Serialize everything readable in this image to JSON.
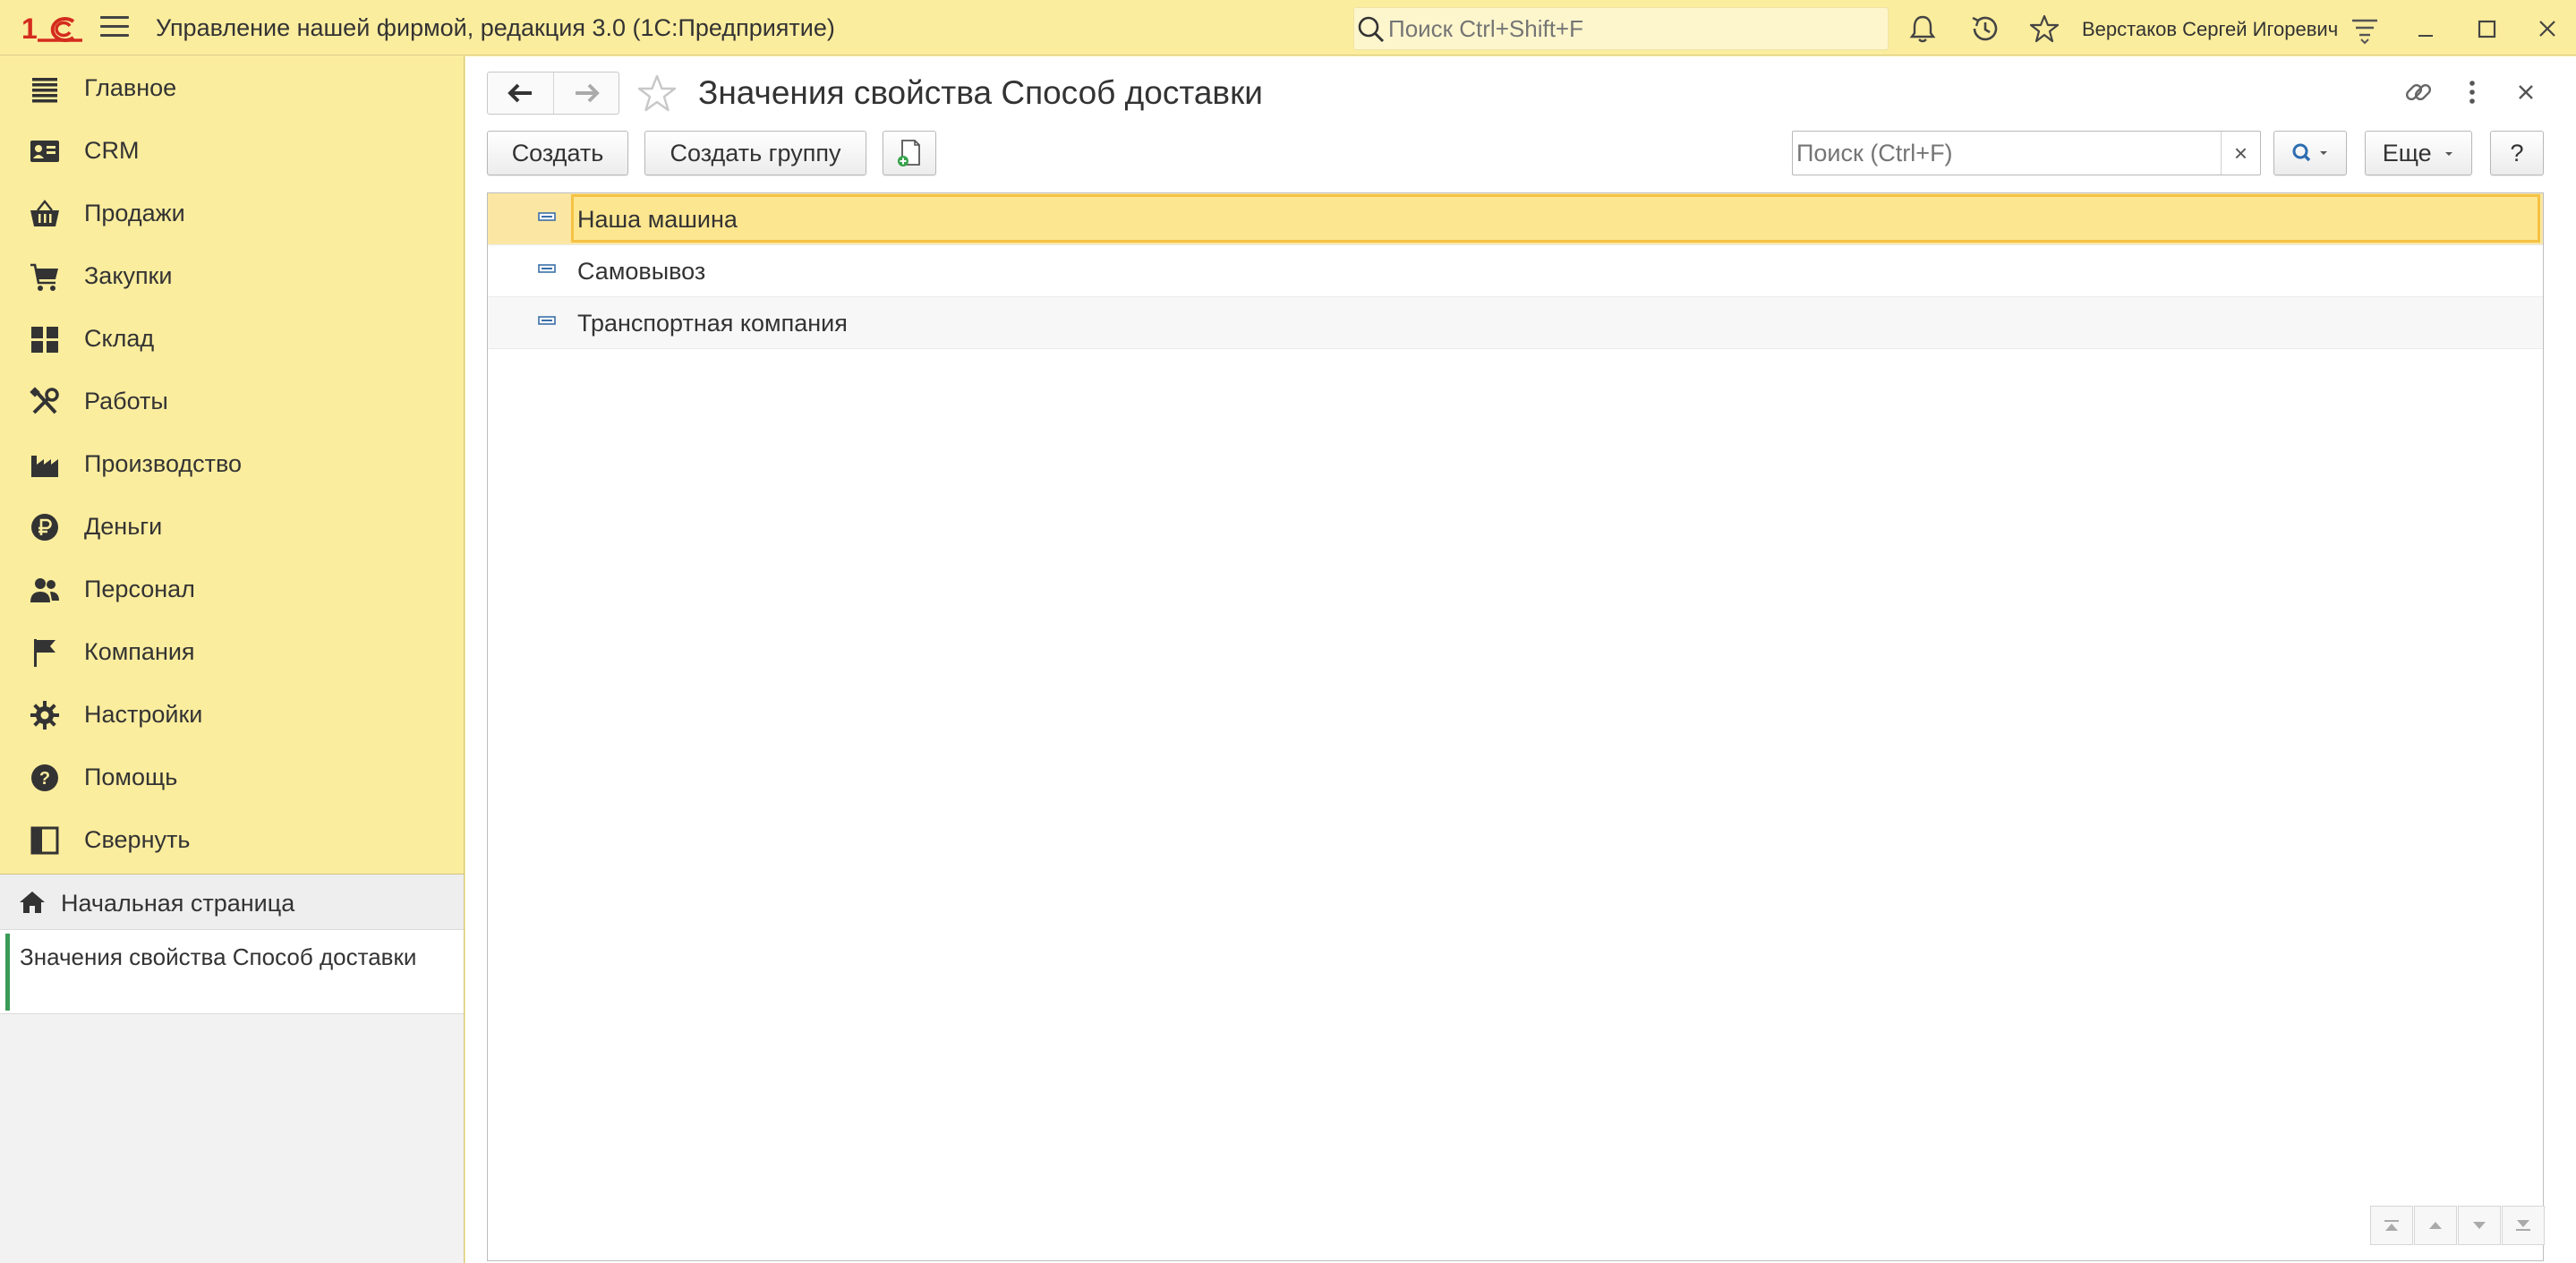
{
  "app": {
    "logo_text": "1С",
    "title": "Управление нашей фирмой, редакция 3.0  (1С:Предприятие)",
    "search_placeholder": "Поиск Ctrl+Shift+F",
    "user_name": "Верстаков Сергей Игоревич"
  },
  "sidebar": {
    "items": [
      {
        "label": "Главное",
        "icon": "list-icon"
      },
      {
        "label": "CRM",
        "icon": "contact-card-icon"
      },
      {
        "label": "Продажи",
        "icon": "basket-icon"
      },
      {
        "label": "Закупки",
        "icon": "cart-icon"
      },
      {
        "label": "Склад",
        "icon": "grid-icon"
      },
      {
        "label": "Работы",
        "icon": "tools-icon"
      },
      {
        "label": "Производство",
        "icon": "factory-icon"
      },
      {
        "label": "Деньги",
        "icon": "ruble-icon"
      },
      {
        "label": "Персонал",
        "icon": "people-icon"
      },
      {
        "label": "Компания",
        "icon": "flag-icon"
      },
      {
        "label": "Настройки",
        "icon": "gear-icon"
      },
      {
        "label": "Помощь",
        "icon": "help-icon"
      },
      {
        "label": "Свернуть",
        "icon": "collapse-panel-icon"
      }
    ],
    "home_link": "Начальная страница",
    "open_windows": [
      "Значения свойства Способ доставки"
    ]
  },
  "form": {
    "title": "Значения свойства Способ доставки",
    "create_label": "Создать",
    "create_group_label": "Создать группу",
    "search_placeholder": "Поиск (Ctrl+F)",
    "clear_label": "×",
    "more_label": "Еще",
    "help_label": "?"
  },
  "list": {
    "rows": [
      {
        "text": "Наша машина",
        "selected": true
      },
      {
        "text": "Самовывоз",
        "selected": false
      },
      {
        "text": "Транспортная компания",
        "selected": false
      }
    ]
  },
  "colors": {
    "panel_yellow": "#fbed9e",
    "selection": "#fbe7a3",
    "selection_border": "#f5c243",
    "logo_red": "#d42b1e",
    "active_green": "#3a9b57"
  }
}
